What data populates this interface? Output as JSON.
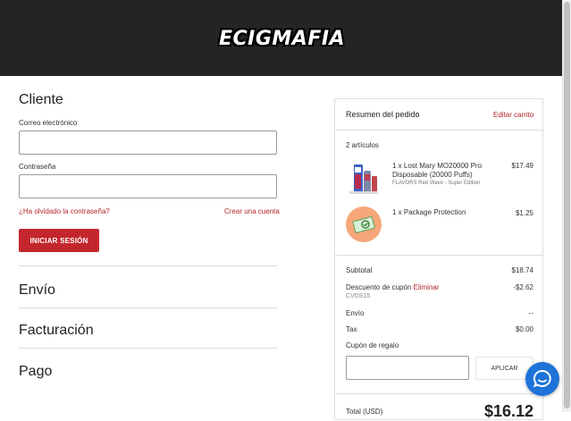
{
  "brand": {
    "logo_text": "ECIGMAFIA"
  },
  "customer": {
    "title": "Cliente",
    "email_label": "Correo electrónico",
    "email_value": "",
    "password_label": "Contraseña",
    "password_value": "",
    "forgot_password": "¿Ha olvidado la contraseña?",
    "create_account": "Crear una cuenta",
    "login_button": "INICIAR SESIÓN"
  },
  "steps": {
    "shipping": "Envío",
    "billing": "Facturación",
    "payment": "Pago"
  },
  "summary": {
    "title": "Resumen del pedido",
    "edit_cart": "Editar carrito",
    "item_count": "2 artículos",
    "items": [
      {
        "qty_name": "1 x Lost Mary MO20000 Pro Disposable (20000 Puffs)",
        "option": "FLAVORS Red Wave - Super Edition",
        "price": "$17.49"
      },
      {
        "qty_name": "1 x Package Protection",
        "option": "",
        "price": "$1.25"
      }
    ],
    "subtotal_label": "Subtotal",
    "subtotal_value": "$18.74",
    "discount_label": "Descuento de cupón",
    "discount_remove": "Eliminar",
    "discount_code": "CVDS15",
    "discount_value": "-$2.62",
    "shipping_label": "Envío",
    "shipping_value": "--",
    "tax_label": "Tax",
    "tax_value": "$0.00",
    "gift_label": "Cupón de regalo",
    "gift_value": "",
    "apply_button": "APLICAR",
    "total_label": "Total (USD)",
    "total_value": "$16.12"
  },
  "colors": {
    "accent": "#c3272d",
    "header_bg": "#242424",
    "chat_bg": "#1e73d8"
  },
  "icons": {
    "chat": "chat-bubble-icon"
  }
}
